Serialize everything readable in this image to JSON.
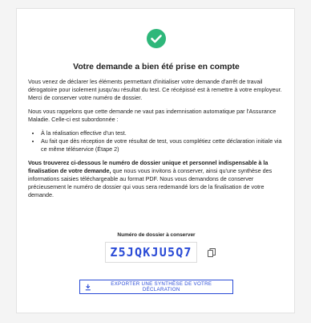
{
  "colors": {
    "success": "#2eb77a",
    "accent": "#2a4bd6"
  },
  "title": "Votre demande a bien été prise en compte",
  "paragraph1": "Vous venez de déclarer les éléments permettant d'initialiser votre demande d'arrêt de travail dérogatoire pour isolement jusqu'au résultat du test. Ce récépissé est à remettre à votre employeur. Merci de conserver votre numéro de dossier.",
  "paragraph2": "Nous vous rappelons que cette demande ne vaut pas indemnisation automatique par l'Assurance Maladie. Celle-ci est subordonnée :",
  "list": [
    "À la réalisation effective d'un test.",
    "Au fait que dès réception de votre résultat de test, vous complétiez cette déclaration initiale via ce même téléservice (Étape 2)"
  ],
  "paragraph3": {
    "bold": "Vous trouverez ci-dessous le numéro de dossier unique et personnel indispensable à la finalisation de votre demande,",
    "rest": " que nous vous invitons à conserver, ainsi qu'une synthèse des informations saisies téléchargeable au format PDF. Nous vous demandons de conserver précieusement le numéro de dossier qui vous sera redemandé lors de la finalisation de votre demande."
  },
  "dossier": {
    "label": "Numéro de dossier à conserver",
    "code": "Z5JQKJU5Q7"
  },
  "icons": {
    "success": "check-circle-icon",
    "copy": "copy-icon",
    "download": "download-icon"
  },
  "export_button": "EXPORTER UNE SYNTHÈSE DE VOTRE DÉCLARATION"
}
